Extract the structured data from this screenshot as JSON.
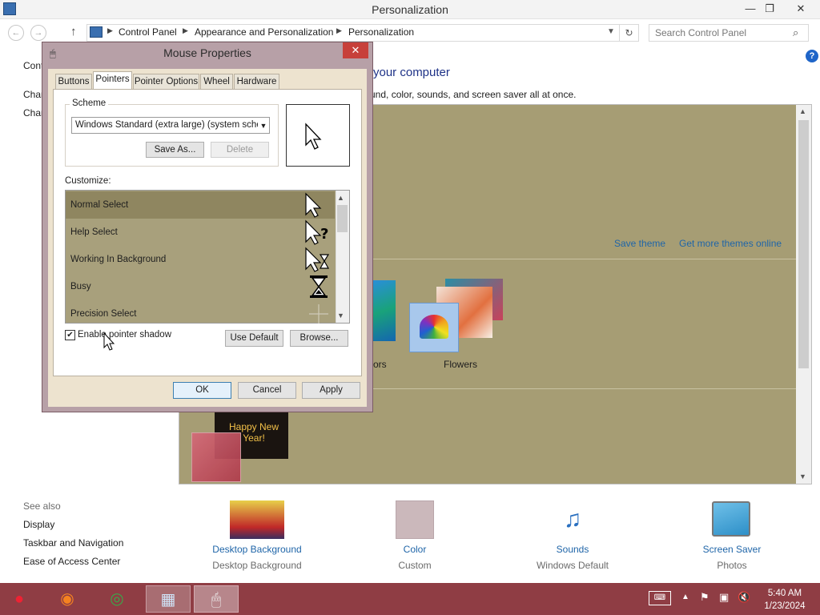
{
  "window": {
    "title": "Personalization",
    "minimize": "—",
    "restore": "❐",
    "close": "✕"
  },
  "address": {
    "crumbs": [
      "Control Panel",
      "Appearance and Personalization",
      "Personalization"
    ],
    "search_placeholder": "Search Control Panel"
  },
  "main": {
    "left_top": "Cont",
    "left_links": [
      "Chan",
      "Chan"
    ],
    "heading": "your computer",
    "subheading": "und, color, sounds, and screen saver all at once.",
    "save_theme": "Save theme",
    "get_more": "Get more themes online",
    "theme_labels": [
      "ors",
      "Flowers"
    ],
    "newyear_text": "Happy New Year!"
  },
  "see_also": {
    "title": "See also",
    "links": [
      "Display",
      "Taskbar and Navigation",
      "Ease of Access Center"
    ]
  },
  "bottom_tiles": [
    {
      "label": "Desktop Background",
      "sub": "Desktop Background"
    },
    {
      "label": "Color",
      "sub": "Custom"
    },
    {
      "label": "Sounds",
      "sub": "Windows Default"
    },
    {
      "label": "Screen Saver",
      "sub": "Photos"
    }
  ],
  "dialog": {
    "title": "Mouse Properties",
    "tabs": [
      "Buttons",
      "Pointers",
      "Pointer Options",
      "Wheel",
      "Hardware"
    ],
    "active_tab": "Pointers",
    "scheme_label": "Scheme",
    "scheme_value": "Windows Standard (extra large) (system scheme)",
    "save_as": "Save As...",
    "delete": "Delete",
    "customize_label": "Customize:",
    "pointers": [
      {
        "name": "Normal Select",
        "icon": "arrow-cursor-icon",
        "glyph": "➤"
      },
      {
        "name": "Help Select",
        "icon": "help-cursor-icon",
        "glyph": "?"
      },
      {
        "name": "Working In Background",
        "icon": "working-cursor-icon",
        "glyph": "⧗"
      },
      {
        "name": "Busy",
        "icon": "hourglass-icon",
        "glyph": "⌛"
      },
      {
        "name": "Precision Select",
        "icon": "crosshair-icon",
        "glyph": "+"
      }
    ],
    "selected_pointer": "Normal Select",
    "enable_shadow_label": "Enable pointer shadow",
    "enable_shadow_checked": true,
    "use_default": "Use Default",
    "browse": "Browse...",
    "ok": "OK",
    "cancel": "Cancel",
    "apply": "Apply"
  },
  "taskbar": {
    "time": "5:40 AM",
    "date": "1/23/2024"
  }
}
